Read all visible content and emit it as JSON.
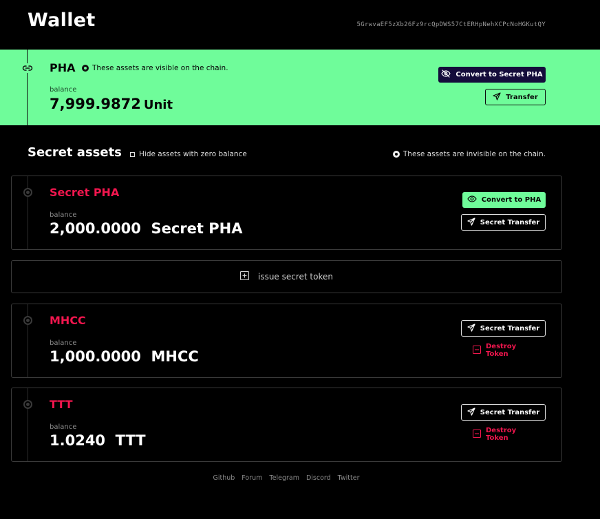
{
  "header": {
    "title": "Wallet",
    "address": "5GrwvaEF5zXb26Fz9rcQpDWS57CtERHpNehXCPcNoHGKutQY"
  },
  "public_asset": {
    "name": "PHA",
    "visibility_note": "These assets are visible on the chain.",
    "balance_label": "balance",
    "balance": "7,999.9872",
    "unit": "Unit",
    "convert_label": "Convert to Secret PHA",
    "transfer_label": "Transfer"
  },
  "secret_section": {
    "title": "Secret assets",
    "hide_zero_label": "Hide assets with zero balance",
    "hide_zero_checked": false,
    "visibility_note": "These assets are invisible on the chain."
  },
  "secret_pha": {
    "name": "Secret PHA",
    "balance_label": "balance",
    "balance": "2,000.0000  Secret PHA",
    "convert_label": "Convert to PHA",
    "transfer_label": "Secret Transfer"
  },
  "issue_token": {
    "label": "issue secret token"
  },
  "tokens": [
    {
      "name": "MHCC",
      "balance_label": "balance",
      "balance": "1,000.0000  MHCC",
      "transfer_label": "Secret Transfer",
      "destroy_label": "Destroy Token"
    },
    {
      "name": "TTT",
      "balance_label": "balance",
      "balance": "1.0240  TTT",
      "transfer_label": "Secret Transfer",
      "destroy_label": "Destroy Token"
    }
  ],
  "footer": {
    "links": [
      "Github",
      "Forum",
      "Telegram",
      "Discord",
      "Twitter"
    ]
  },
  "colors": {
    "accent_green": "#6ffc9a",
    "secret_red": "#f2164e",
    "dark_button": "#140c3b"
  },
  "icons": {
    "public_asset": "link-icon",
    "convert_secret": "eye-off-icon",
    "convert_public": "eye-icon",
    "transfer": "send-icon",
    "issue": "plus-square-icon",
    "destroy": "minus-square-icon"
  }
}
